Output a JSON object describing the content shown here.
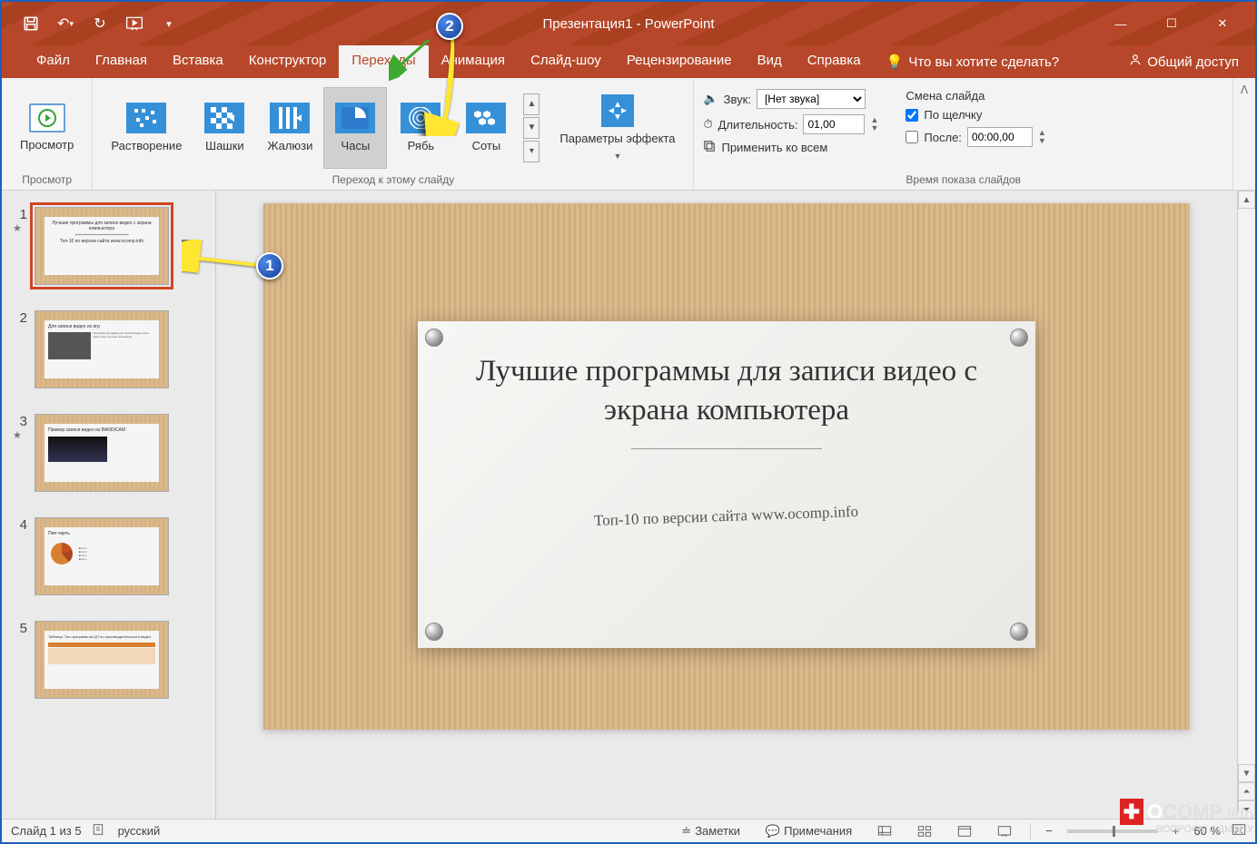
{
  "titlebar": {
    "title": "Презентация1 - PowerPoint"
  },
  "tabs": {
    "file": "Файл",
    "home": "Главная",
    "insert": "Вставка",
    "design": "Конструктор",
    "transitions": "Переходы",
    "animations": "Анимация",
    "slideshow": "Слайд-шоу",
    "review": "Рецензирование",
    "view": "Вид",
    "help": "Справка",
    "tell_me": "Что вы хотите сделать?",
    "share": "Общий доступ"
  },
  "ribbon": {
    "preview_group": {
      "button": "Просмотр",
      "label": "Просмотр"
    },
    "transitions_group": {
      "items": [
        "Растворение",
        "Шашки",
        "Жалюзи",
        "Часы",
        "Рябь",
        "Соты"
      ],
      "effect_options": "Параметры эффекта",
      "label": "Переход к этому слайду"
    },
    "timing_group": {
      "sound_label": "Звук:",
      "sound_value": "[Нет звука]",
      "duration_label": "Длительность:",
      "duration_value": "01,00",
      "apply_all": "Применить ко всем",
      "advance_heading": "Смена слайда",
      "on_click": "По щелчку",
      "after_label": "После:",
      "after_value": "00:00,00",
      "label": "Время показа слайдов"
    }
  },
  "thumbnails": [
    {
      "num": "1",
      "starred": true,
      "title": "Лучшие программы для записи видео с экрана компьютера",
      "sub": "Топ-10 по версии сайта www.ocomp.info"
    },
    {
      "num": "2",
      "starred": false,
      "title": "Для записи видео из игр"
    },
    {
      "num": "3",
      "starred": true,
      "title": "Пример записи видео из BANDICAM"
    },
    {
      "num": "4",
      "starred": false,
      "title": "Пие-чарть"
    },
    {
      "num": "5",
      "starred": false,
      "title": "Таблица: Топ программ на ЦП по производительности видео"
    }
  ],
  "slide": {
    "title": "Лучшие программы для записи видео с экрана компьютера",
    "subtitle": "Топ-10 по версии сайта www.ocomp.info"
  },
  "statusbar": {
    "slide_info": "Слайд 1 из 5",
    "language": "русский",
    "notes": "Заметки",
    "comments": "Примечания",
    "zoom": "60 %"
  },
  "callouts": {
    "one": "1",
    "two": "2"
  },
  "watermark": {
    "line1_a": "O",
    "line1_b": "COMP",
    "line1_c": ".info",
    "line2": "ВОПРОСЫ АДМИНУ"
  }
}
